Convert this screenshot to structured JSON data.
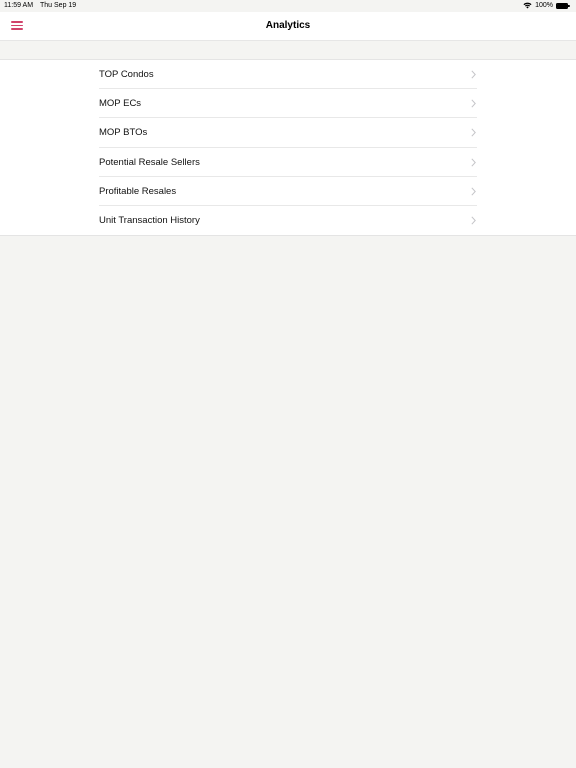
{
  "status_bar": {
    "time": "11:59 AM",
    "date": "Thu Sep 19",
    "battery": "100%"
  },
  "nav": {
    "title": "Analytics",
    "accent_color": "#d1436b"
  },
  "menu": {
    "items": [
      {
        "label": "TOP Condos"
      },
      {
        "label": "MOP ECs"
      },
      {
        "label": "MOP BTOs"
      },
      {
        "label": "Potential Resale Sellers"
      },
      {
        "label": "Profitable Resales"
      },
      {
        "label": "Unit Transaction History"
      }
    ]
  }
}
